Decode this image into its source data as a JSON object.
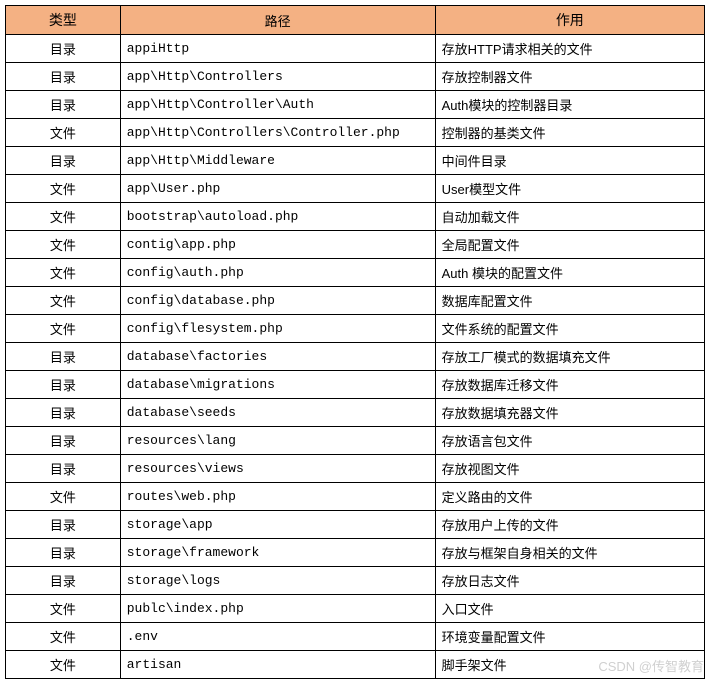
{
  "headers": {
    "type": "类型",
    "path": "路径",
    "purpose": "作用"
  },
  "rows": [
    {
      "type": "目录",
      "path": "appiHttp",
      "purpose": "存放HTTP请求相关的文件"
    },
    {
      "type": "目录",
      "path": "app\\Http\\Controllers",
      "purpose": "存放控制器文件"
    },
    {
      "type": "目录",
      "path": "app\\Http\\Controller\\Auth",
      "purpose": "Auth模块的控制器目录"
    },
    {
      "type": "文件",
      "path": "app\\Http\\Controllers\\Controller.php",
      "purpose": "控制器的基类文件"
    },
    {
      "type": "目录",
      "path": "app\\Http\\Middleware",
      "purpose": "中间件目录"
    },
    {
      "type": "文件",
      "path": "app\\User.php",
      "purpose": "User模型文件"
    },
    {
      "type": "文件",
      "path": "bootstrap\\autoload.php",
      "purpose": "自动加载文件"
    },
    {
      "type": "文件",
      "path": "contig\\app.php",
      "purpose": "全局配置文件"
    },
    {
      "type": "文件",
      "path": "config\\auth.php",
      "purpose": "Auth 模块的配置文件"
    },
    {
      "type": "文件",
      "path": "config\\database.php",
      "purpose": "数据库配置文件"
    },
    {
      "type": "文件",
      "path": "config\\flesystem.php",
      "purpose": "文件系统的配置文件"
    },
    {
      "type": "目录",
      "path": "database\\factories",
      "purpose": "存放工厂模式的数据填充文件"
    },
    {
      "type": "目录",
      "path": "database\\migrations",
      "purpose": "存放数据库迁移文件"
    },
    {
      "type": "目录",
      "path": "database\\seeds",
      "purpose": "存放数据填充器文件"
    },
    {
      "type": "目录",
      "path": "resources\\lang",
      "purpose": "存放语言包文件"
    },
    {
      "type": "目录",
      "path": "resources\\views",
      "purpose": "存放视图文件"
    },
    {
      "type": "文件",
      "path": "routes\\web.php",
      "purpose": "定义路由的文件"
    },
    {
      "type": "目录",
      "path": "storage\\app",
      "purpose": "存放用户上传的文件"
    },
    {
      "type": "目录",
      "path": "storage\\framework",
      "purpose": "存放与框架自身相关的文件"
    },
    {
      "type": "目录",
      "path": "storage\\logs",
      "purpose": "存放日志文件"
    },
    {
      "type": "文件",
      "path": "publc\\index.php",
      "purpose": "入口文件"
    },
    {
      "type": "文件",
      "path": ".env",
      "purpose": "环境变量配置文件"
    },
    {
      "type": "文件",
      "path": "artisan",
      "purpose": "脚手架文件"
    }
  ],
  "watermark": "CSDN @传智教育"
}
